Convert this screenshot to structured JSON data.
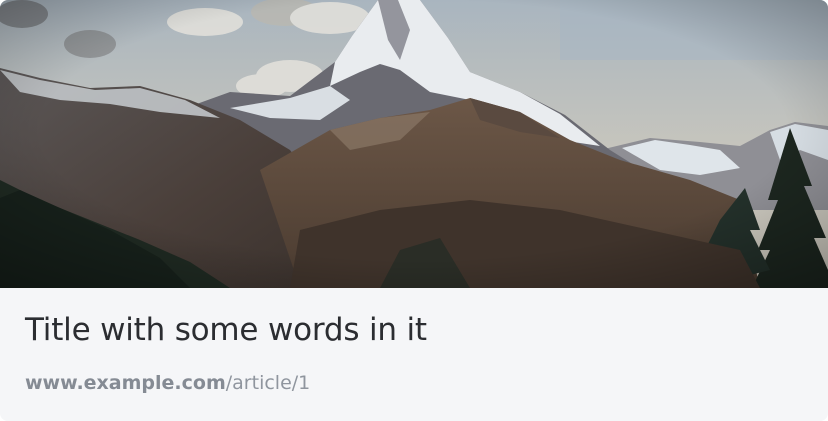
{
  "card": {
    "title": "Title with some words in it",
    "link": {
      "domain": "www.example.com",
      "path": "/article/1"
    },
    "image": {
      "subject": "mountain-landscape"
    }
  }
}
